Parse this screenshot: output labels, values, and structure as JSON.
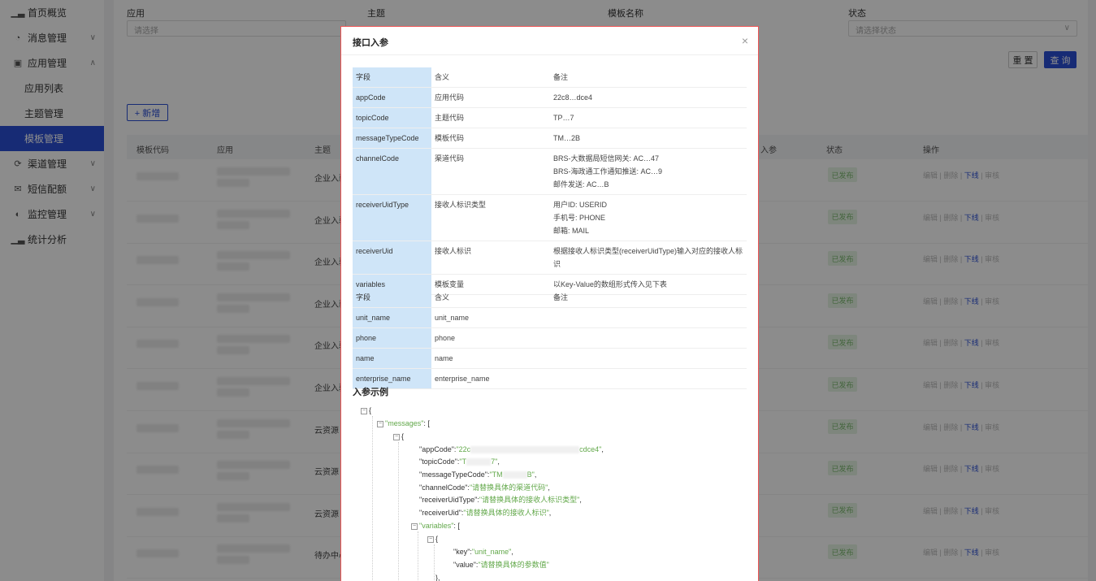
{
  "sidebar": {
    "items": [
      {
        "label": "首页概览",
        "icon": "chart-icon",
        "chev": ""
      },
      {
        "label": "消息管理",
        "icon": "bell-icon",
        "chev": "∨"
      },
      {
        "label": "应用管理",
        "icon": "box-icon",
        "chev": "∧"
      },
      {
        "label": "应用列表",
        "icon": "",
        "chev": ""
      },
      {
        "label": "主题管理",
        "icon": "",
        "chev": ""
      },
      {
        "label": "模板管理",
        "icon": "",
        "chev": ""
      },
      {
        "label": "渠道管理",
        "icon": "channel-icon",
        "chev": "∨"
      },
      {
        "label": "短信配额",
        "icon": "mail-icon",
        "chev": "∨"
      },
      {
        "label": "监控管理",
        "icon": "monitor-icon",
        "chev": "∨"
      },
      {
        "label": "统计分析",
        "icon": "stats-icon",
        "chev": ""
      }
    ],
    "active_index": 5
  },
  "filters": {
    "app_label": "应用",
    "topic_label": "主题",
    "template_label": "模板名称",
    "status_label": "状态",
    "app_placeholder": "请选择",
    "status_placeholder": "请选择状态"
  },
  "buttons": {
    "reset": "重 置",
    "query": "查 询",
    "add": "+ 新增"
  },
  "table": {
    "headers": [
      "模板代码",
      "应用",
      "主题",
      "入参",
      "状态",
      "操作"
    ],
    "rows": [
      {
        "topic": "企业入驻"
      },
      {
        "topic": "企业入驻"
      },
      {
        "topic": "企业入驻"
      },
      {
        "topic": "企业入驻"
      },
      {
        "topic": "企业入驻"
      },
      {
        "topic": "企业入驻"
      },
      {
        "topic": "云资源"
      },
      {
        "topic": "云资源"
      },
      {
        "topic": "云资源"
      },
      {
        "topic": "待办中心"
      }
    ],
    "status_label": "已发布",
    "ops": {
      "edit": "编辑",
      "delete": "删除",
      "offline": "下线",
      "audit": "审核"
    }
  },
  "modal": {
    "title": "接口入参",
    "close": "×",
    "table1": [
      [
        "字段",
        "含义",
        "备注"
      ],
      [
        "appCode",
        "应用代码",
        "22c8…dce4"
      ],
      [
        "topicCode",
        "主题代码",
        "TP…7"
      ],
      [
        "messageTypeCode",
        "模板代码",
        "TM…2B"
      ],
      [
        "channelCode",
        "渠道代码",
        "BRS-大数据局短信网关: AC…47\nBRS-海政通工作通知推送: AC…9\n邮件发送: AC…B"
      ],
      [
        "receiverUidType",
        "接收人标识类型",
        "用户ID: USERID\n手机号: PHONE\n邮箱: MAIL"
      ],
      [
        "receiverUid",
        "接收人标识",
        "根据接收人标识类型(receiverUidType)输入对应的接收人标识"
      ],
      [
        "variables",
        "模板变量",
        "以Key-Value的数组形式传入见下表"
      ]
    ],
    "table2": [
      [
        "字段",
        "含义",
        "备注"
      ],
      [
        "unit_name",
        "unit_name",
        ""
      ],
      [
        "phone",
        "phone",
        ""
      ],
      [
        "name",
        "name",
        ""
      ],
      [
        "enterprise_name",
        "enterprise_name",
        ""
      ]
    ],
    "example_title": "入参示例",
    "code": {
      "l1": "{",
      "l2_key": "\"messages\"",
      "l2_rest": ": [",
      "l3": "{",
      "appCode_key": "\"appCode\":",
      "appCode_val1": "\"22c",
      "appCode_val2": "cdce4\"",
      "topicCode_key": "\"topicCode\":",
      "topicCode_val1": "\"T",
      "topicCode_val2": "7\"",
      "mtc_key": "\"messageTypeCode\":",
      "mtc_val1": "\"TM",
      "mtc_val2": "B\"",
      "channel_key": "\"channelCode\":",
      "channel_val": "\"请替换具体的渠道代码\"",
      "rut_key": "\"receiverUidType\":",
      "rut_val": "\"请替换具体的接收人标识类型\"",
      "ru_key": "\"receiverUid\":",
      "ru_val": "\"请替换具体的接收人标识\"",
      "var_key": "\"variables\"",
      "var_rest": ": [",
      "l4": "{",
      "key_key": "\"key\":",
      "key_val": "\"unit_name\"",
      "value_key": "\"value\":",
      "value_val": "\"请替换具体的参数值\"",
      "close": "},",
      "comma": ","
    }
  }
}
